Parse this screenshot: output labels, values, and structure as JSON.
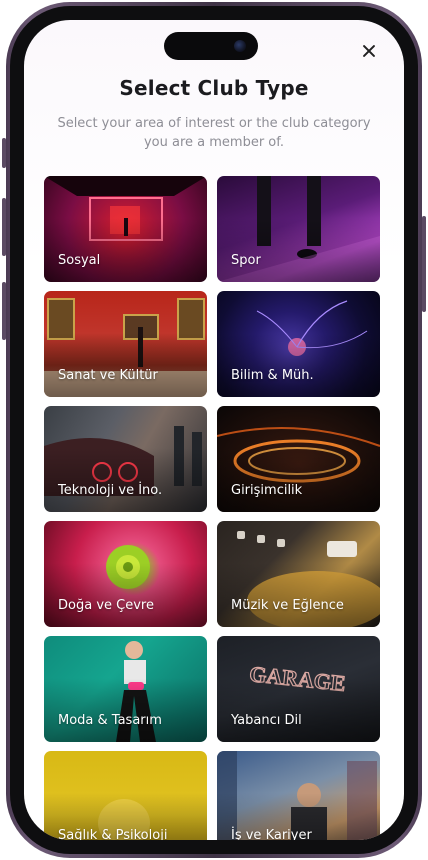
{
  "header": {
    "title": "Select Club Type",
    "subtitle": "Select your area of interest or the club category you are a member of."
  },
  "close_icon": "close-icon",
  "categories": [
    {
      "label": "Sosyal"
    },
    {
      "label": "Spor"
    },
    {
      "label": "Sanat ve Kültür"
    },
    {
      "label": "Bilim & Müh."
    },
    {
      "label": "Teknoloji ve İno."
    },
    {
      "label": "Girişimcilik"
    },
    {
      "label": "Doğa ve Çevre"
    },
    {
      "label": "Müzik ve Eğlence"
    },
    {
      "label": "Moda & Tasarım"
    },
    {
      "label": "Yabancı Dil"
    },
    {
      "label": "Sağlık & Psikoloji"
    },
    {
      "label": "İş ve Kariyer"
    }
  ],
  "garage_sign": "GARAGE",
  "colors": {
    "frame": "#5b4a63",
    "title": "#1b1b1f",
    "subtitle": "#8e8e96"
  }
}
